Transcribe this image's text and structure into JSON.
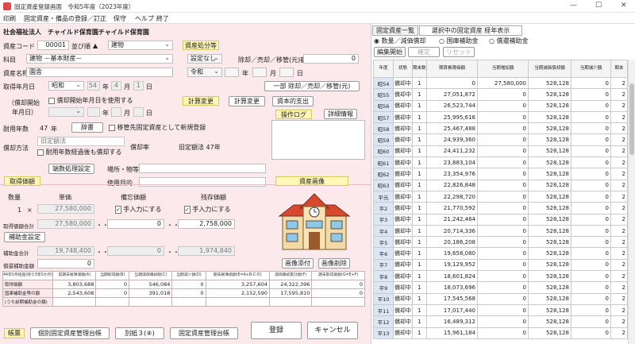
{
  "window": {
    "title": "固定資産登録画面",
    "fiscal_year": "令和5年度（2023年度）",
    "minimize": "—",
    "maximize": "☐",
    "close": "✕"
  },
  "menu": [
    "印刷",
    "固定資産・備品の登録／訂正",
    "保守",
    "ヘルプ",
    "終了"
  ],
  "org": {
    "name": "社会福祉法人　チャイルド保育園チャイルド保育園",
    "code_label": "資産コード",
    "code": "00001",
    "sort_label": "並び順",
    "category1": "建物",
    "subject_label": "科目",
    "subject": "建物 －基本財産－",
    "asset_name_label": "資産名称",
    "asset_name": "園舎"
  },
  "acquire": {
    "label": "取得年月日",
    "era": "昭和",
    "year": "54",
    "y": "年",
    "month": "4",
    "m": "月",
    "day": "1",
    "d": "日",
    "depstart_label1": "（償却開始",
    "depstart_label2": "年月日）",
    "depstart_check": "償却開始年月日を使用する",
    "y2": "年",
    "m2": "月",
    "d2": "日"
  },
  "life": {
    "label": "耐用年数",
    "years": "47",
    "unit": "年",
    "dict_button": "辞書",
    "transfer_check": "移管先固定資産として新規登録",
    "method_label": "償却方法",
    "method": "旧定額法",
    "rate_label": "償却率",
    "rate_text": "旧定額法 47年",
    "over_check": "耐用年数経過後も償却する",
    "fraction_button": "端数処理設定",
    "place_label": "場所・物等",
    "purpose_label": "使用目的"
  },
  "disposal": {
    "header": "資産処分等",
    "kind": "設定なし",
    "amount_label": "除却／売却／移管(元)額",
    "amount": "0",
    "era": "令和",
    "y": "年",
    "m": "月",
    "d": "日",
    "partial_button": "一部 除却／売却／移管(元)",
    "calc_change": "計算変更",
    "calc_change_button": "計算変更",
    "capex_button": "資本的支出"
  },
  "log": {
    "title": "操作ログ",
    "detail_button": "詳細情報"
  },
  "image": {
    "title": "資産画像",
    "attach": "画像添付",
    "delete": "画像削除"
  },
  "price": {
    "header": "取得価額",
    "qty_label": "数量",
    "unit_label": "単価",
    "memo_label": "備忘価額",
    "residual_label": "残存価額",
    "qty": "1",
    "x": "×",
    "unit_price": "27,580,000",
    "manual1": "手入力にする",
    "manual2": "手入力にする",
    "total_label": "取得価額合計",
    "total": "27,580,000",
    "dots": "・・・",
    "memo": "0",
    "residual": "2,758,000",
    "subsidy_button": "補助金設定",
    "subsidy_total_label": "補助金合計",
    "subsidy_total": "19,748,400",
    "subsidy_memo": "0",
    "subsidy_residual": "1,974,840",
    "reserve_label": "償還補助金額",
    "reserve": "0"
  },
  "summary": {
    "headers": [
      "44年0月経過(残り3年0か月)",
      "前期末帳簿価額(A)",
      "当期取得額(B)",
      "当期減価償却額(C)",
      "当期減少額(D)",
      "期末帳簿価額(E=A+B-C-D)",
      "減価償却累計額(F)",
      "期末取得価額(G=E+F)"
    ],
    "rows": [
      {
        "label": "取得価額",
        "values": [
          "3,803,688",
          "0",
          "546,084",
          "0",
          "3,257,604",
          "24,322,396",
          "0"
        ]
      },
      {
        "label": "国庫補助金等の額",
        "values": [
          "2,543,608",
          "0",
          "391,018",
          "0",
          "2,152,590",
          "17,595,810",
          "0"
        ]
      },
      {
        "label": "(うち前期補助金の額)",
        "values": [
          "",
          "",
          "",
          "",
          "",
          "",
          ""
        ]
      }
    ]
  },
  "footer": {
    "slip": "帳票",
    "b1": "個別固定資産管理台帳",
    "b2": "別紙３(⑧)",
    "b3": "固定資産管理台帳",
    "register": "登録",
    "cancel": "キャンセル"
  },
  "right": {
    "tab1": "固定資産一覧",
    "tab2": "選択中の固定資産 経年表示",
    "radio1": "数量／減価償却",
    "radio2": "国庫補助金",
    "radio3": "償還補助金",
    "edit_start": "編集開始",
    "confirm": "確定",
    "reset": "リセット",
    "headers": [
      "年度",
      "状態",
      "期末数量",
      "期首帳簿価額",
      "当期増加額",
      "当期減価償却額",
      "当期減少額",
      "期末"
    ],
    "rows": [
      [
        "昭54",
        "償却中",
        "1",
        "0",
        "27,580,000",
        "528,128",
        "0",
        "2"
      ],
      [
        "昭55",
        "償却中",
        "1",
        "27,051,872",
        "0",
        "528,128",
        "0",
        "2"
      ],
      [
        "昭56",
        "償却中",
        "1",
        "26,523,744",
        "0",
        "528,128",
        "0",
        "2"
      ],
      [
        "昭57",
        "償却中",
        "1",
        "25,995,616",
        "0",
        "528,128",
        "0",
        "2"
      ],
      [
        "昭58",
        "償却中",
        "1",
        "25,467,488",
        "0",
        "528,128",
        "0",
        "2"
      ],
      [
        "昭59",
        "償却中",
        "1",
        "24,939,360",
        "0",
        "528,128",
        "0",
        "2"
      ],
      [
        "昭60",
        "償却中",
        "1",
        "24,411,232",
        "0",
        "528,128",
        "0",
        "2"
      ],
      [
        "昭61",
        "償却中",
        "1",
        "23,883,104",
        "0",
        "528,128",
        "0",
        "2"
      ],
      [
        "昭62",
        "償却中",
        "1",
        "23,354,976",
        "0",
        "528,128",
        "0",
        "2"
      ],
      [
        "昭63",
        "償却中",
        "1",
        "22,826,848",
        "0",
        "528,128",
        "0",
        "2"
      ],
      [
        "平元",
        "償却中",
        "1",
        "22,298,720",
        "0",
        "528,128",
        "0",
        "2"
      ],
      [
        "平2",
        "償却中",
        "1",
        "21,770,592",
        "0",
        "528,128",
        "0",
        "2"
      ],
      [
        "平3",
        "償却中",
        "1",
        "21,242,464",
        "0",
        "528,128",
        "0",
        "2"
      ],
      [
        "平4",
        "償却中",
        "1",
        "20,714,336",
        "0",
        "528,128",
        "0",
        "2"
      ],
      [
        "平5",
        "償却中",
        "1",
        "20,186,208",
        "0",
        "528,128",
        "0",
        "2"
      ],
      [
        "平6",
        "償却中",
        "1",
        "19,658,080",
        "0",
        "528,128",
        "0",
        "2"
      ],
      [
        "平7",
        "償却中",
        "1",
        "19,129,952",
        "0",
        "528,128",
        "0",
        "2"
      ],
      [
        "平8",
        "償却中",
        "1",
        "18,601,824",
        "0",
        "528,128",
        "0",
        "2"
      ],
      [
        "平9",
        "償却中",
        "1",
        "18,073,696",
        "0",
        "528,128",
        "0",
        "2"
      ],
      [
        "平10",
        "償却中",
        "1",
        "17,545,568",
        "0",
        "528,128",
        "0",
        "2"
      ],
      [
        "平11",
        "償却中",
        "1",
        "17,017,440",
        "0",
        "528,128",
        "0",
        "2"
      ],
      [
        "平12",
        "償却中",
        "1",
        "16,489,312",
        "0",
        "528,128",
        "0",
        "2"
      ],
      [
        "平13",
        "償却中",
        "1",
        "15,961,184",
        "0",
        "528,128",
        "0",
        "2"
      ]
    ]
  }
}
